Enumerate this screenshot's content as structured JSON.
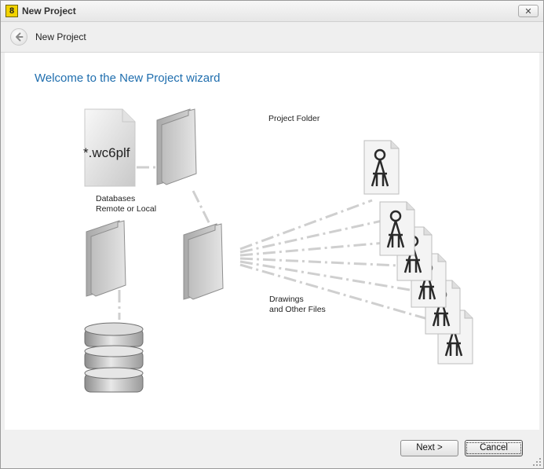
{
  "window": {
    "title": "New Project",
    "close_glyph": "✕",
    "app_icon_text": "8"
  },
  "nav": {
    "title": "New Project"
  },
  "content": {
    "heading": "Welcome to the New Project wizard",
    "file_label": "*.wc6plf",
    "databases_label_line1": "Databases",
    "databases_label_line2": "Remote or Local",
    "project_folder_label": "Project Folder",
    "drawings_label_line1": "Drawings",
    "drawings_label_line2": "and Other Files"
  },
  "buttons": {
    "next": "Next >",
    "cancel": "Cancel"
  },
  "icons": [
    "app-icon",
    "close-icon",
    "back-arrow-icon",
    "file-icon",
    "folder-icon",
    "database-icon",
    "drawing-file-icon",
    "resize-grip-icon"
  ],
  "colors": {
    "accent": "#1f6eae",
    "folder": "#b5b5b5",
    "connector": "#cfcfcf"
  }
}
